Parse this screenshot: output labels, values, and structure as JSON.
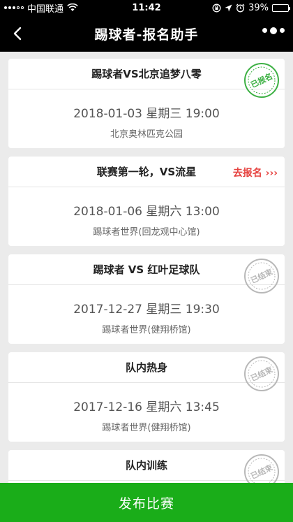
{
  "status": {
    "carrier": "中国联通",
    "time": "11:42",
    "battery": "39%",
    "battery_level": 0.39
  },
  "nav": {
    "title": "踢球者-报名助手"
  },
  "cards": [
    {
      "title": "踢球者VS北京追梦八零",
      "time": "2018-01-03  星期三  19:00",
      "place": "北京奥林匹克公园",
      "stamp": "已报名",
      "stamp_color": "#3cb043"
    },
    {
      "title": "联赛第一轮，VS流星",
      "time": "2018-01-06  星期六  13:00",
      "place": "踢球者世界(回龙观中心馆)",
      "action": "去报名 ›››"
    },
    {
      "title": "踢球者 VS 红叶足球队",
      "time": "2017-12-27  星期三  19:30",
      "place": "踢球者世界(健翔桥馆)",
      "stamp": "已结束",
      "stamp_color": "#b8b8b8"
    },
    {
      "title": "队内热身",
      "time": "2017-12-16  星期六  13:45",
      "place": "踢球者世界(健翔桥馆)",
      "stamp": "已结束",
      "stamp_color": "#b8b8b8"
    },
    {
      "title": "队内训练",
      "stamp": "已结束",
      "stamp_color": "#b8b8b8"
    }
  ],
  "footer": {
    "publish_label": "发布比赛"
  }
}
